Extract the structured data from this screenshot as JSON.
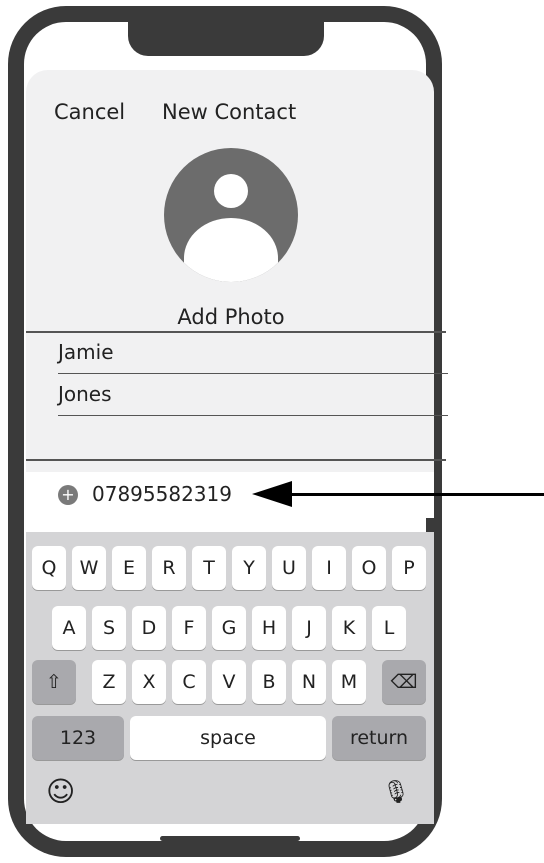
{
  "nav": {
    "cancel_label": "Cancel",
    "title": "New Contact"
  },
  "photo": {
    "add_label": "Add Photo"
  },
  "fields": {
    "first_name": "Jamie",
    "last_name": "Jones",
    "company": ""
  },
  "phone": {
    "add_glyph": "+",
    "number": "07895582319"
  },
  "keyboard": {
    "row1": [
      "Q",
      "W",
      "E",
      "R",
      "T",
      "Y",
      "U",
      "I",
      "O",
      "P"
    ],
    "row2": [
      "A",
      "S",
      "D",
      "F",
      "G",
      "H",
      "J",
      "K",
      "L"
    ],
    "row3": [
      "Z",
      "X",
      "C",
      "V",
      "B",
      "N",
      "M"
    ],
    "shift_glyph": "⇧",
    "delete_glyph": "⌫",
    "numbers_label": "123",
    "space_label": "space",
    "return_label": "return",
    "emoji_glyph": "☺",
    "mic_glyph": "🎙"
  },
  "colors": {
    "frame": "#3a3a3a",
    "sheet": "#f1f1f2",
    "keyboard": "#d4d4d6",
    "avatar": "#6c6c6c"
  }
}
